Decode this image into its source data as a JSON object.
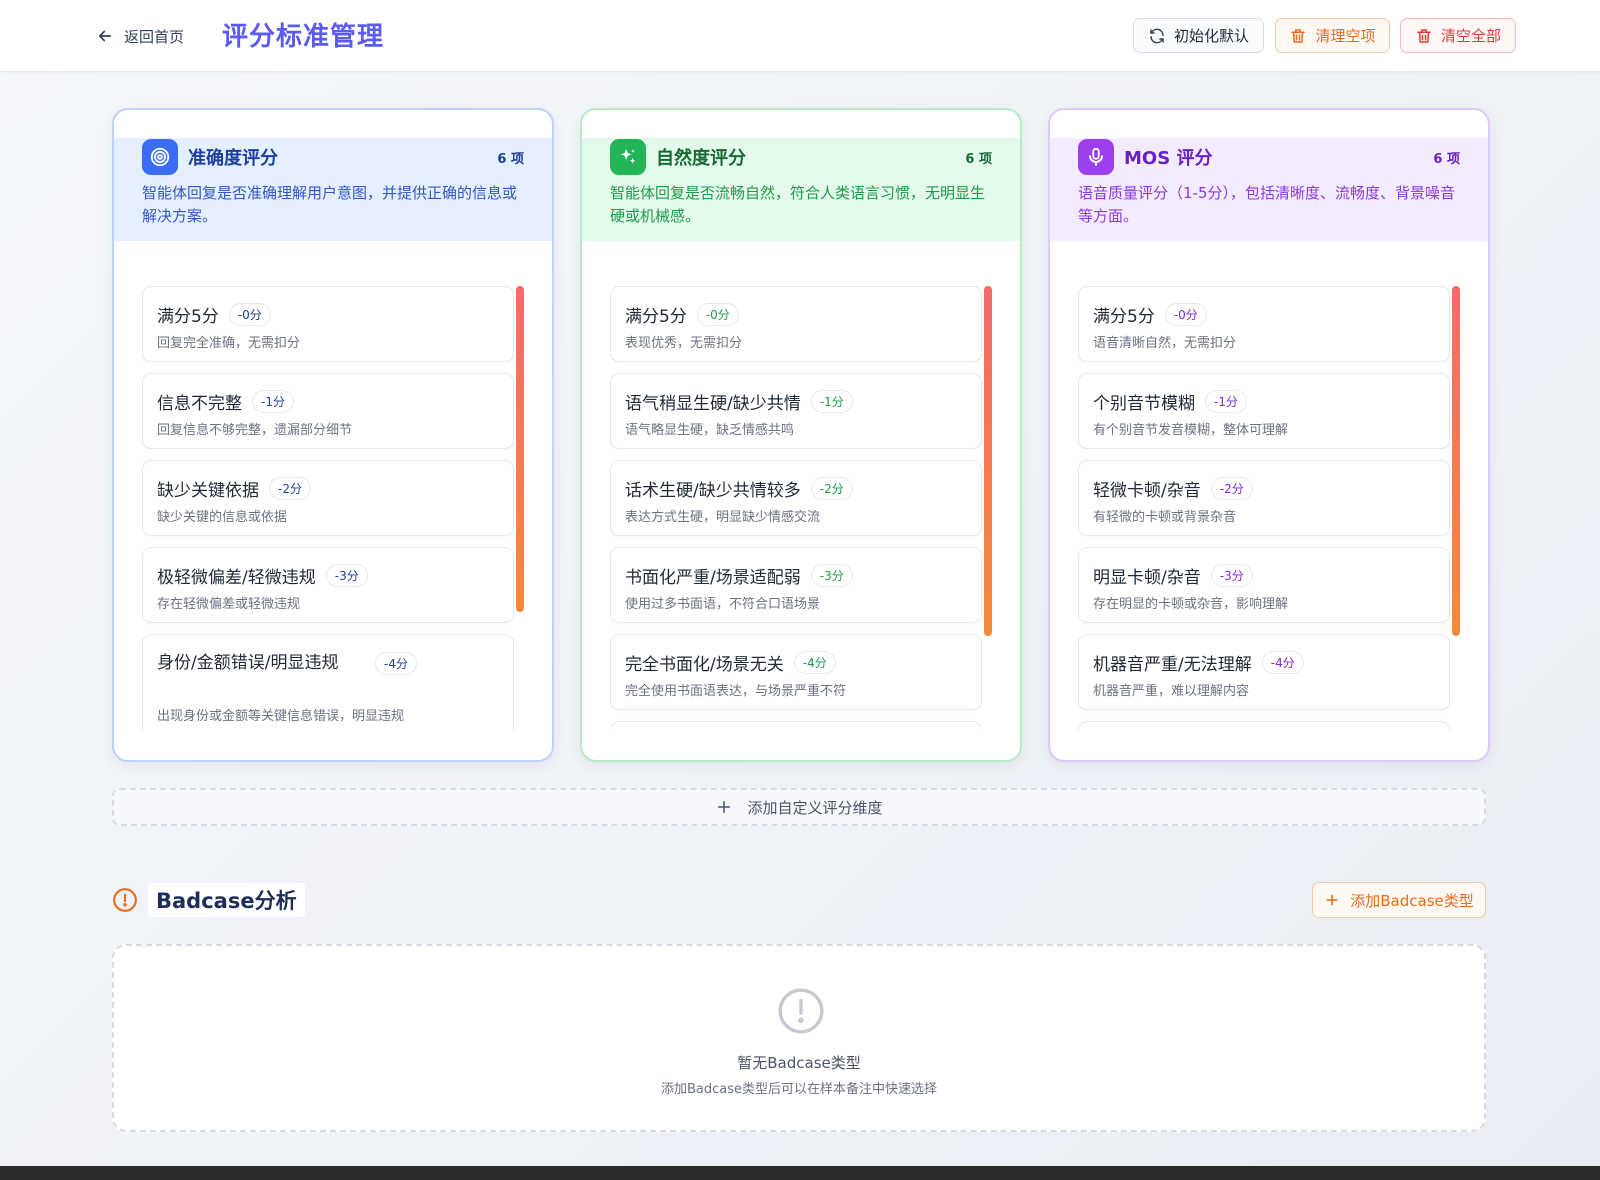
{
  "header": {
    "back_label": "返回首页",
    "title": "评分标准管理",
    "buttons": {
      "init_default": "初始化默认",
      "clean_empty": "清理空项",
      "clear_all": "清空全部"
    }
  },
  "dimensions": [
    {
      "title": "准确度评分",
      "count": "6 项",
      "description": "智能体回复是否准确理解用户意图，并提供正确的信息或解决方案。",
      "icon": "target-icon",
      "accent": "#3b6cf6",
      "items": [
        {
          "name": "满分5分",
          "points": "-0分",
          "desc": "回复完全准确，无需扣分"
        },
        {
          "name": "信息不完整",
          "points": "-1分",
          "desc": "回复信息不够完整，遗漏部分细节"
        },
        {
          "name": "缺少关键依据",
          "points": "-2分",
          "desc": "缺少关键的信息或依据"
        },
        {
          "name": "极轻微偏差/轻微违规",
          "points": "-3分",
          "desc": "存在轻微偏差或轻微违规"
        },
        {
          "name": "身份/金额错误/明显违规",
          "points": "-4分",
          "desc": "出现身份或金额等关键信息错误，明显违规"
        }
      ]
    },
    {
      "title": "自然度评分",
      "count": "6 项",
      "description": "智能体回复是否流畅自然，符合人类语言习惯，无明显生硬或机械感。",
      "icon": "sparkle-icon",
      "accent": "#22b556",
      "items": [
        {
          "name": "满分5分",
          "points": "-0分",
          "desc": "表现优秀，无需扣分"
        },
        {
          "name": "语气稍显生硬/缺少共情",
          "points": "-1分",
          "desc": "语气略显生硬，缺乏情感共鸣"
        },
        {
          "name": "话术生硬/缺少共情较多",
          "points": "-2分",
          "desc": "表达方式生硬，明显缺少情感交流"
        },
        {
          "name": "书面化严重/场景适配弱",
          "points": "-3分",
          "desc": "使用过多书面语，不符合口语场景"
        },
        {
          "name": "完全书面化/场景无关",
          "points": "-4分",
          "desc": "完全使用书面语表达，与场景严重不符"
        }
      ]
    },
    {
      "title": "MOS 评分",
      "count": "6 项",
      "description": "语音质量评分（1-5分），包括清晰度、流畅度、背景噪音等方面。",
      "icon": "microphone-icon",
      "accent": "#9b3ff0",
      "items": [
        {
          "name": "满分5分",
          "points": "-0分",
          "desc": "语音清晰自然，无需扣分"
        },
        {
          "name": "个别音节模糊",
          "points": "-1分",
          "desc": "有个别音节发音模糊，整体可理解"
        },
        {
          "name": "轻微卡顿/杂音",
          "points": "-2分",
          "desc": "有轻微的卡顿或背景杂音"
        },
        {
          "name": "明显卡顿/杂音",
          "points": "-3分",
          "desc": "存在明显的卡顿或杂音，影响理解"
        },
        {
          "name": "机器音严重/无法理解",
          "points": "-4分",
          "desc": "机器音严重，难以理解内容"
        }
      ]
    }
  ],
  "add_dimension_label": "添加自定义评分维度",
  "badcase": {
    "title": "Badcase分析",
    "add_button": "添加Badcase类型",
    "empty_title": "暂无Badcase类型",
    "empty_subtitle": "添加Badcase类型后可以在样本备注中快速选择"
  }
}
